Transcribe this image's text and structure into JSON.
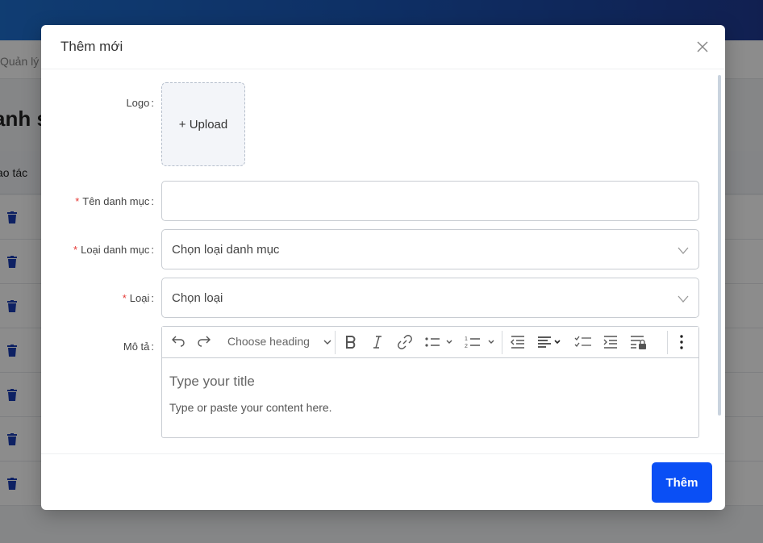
{
  "background": {
    "breadcrumb": "Quản lý",
    "page_title": "anh s",
    "table_header": "ao tác",
    "row_count": 7
  },
  "modal": {
    "title": "Thêm mới",
    "submit_label": "Thêm",
    "fields": {
      "logo": {
        "label": "Logo",
        "upload_text": "+ Upload"
      },
      "category_name": {
        "label": "Tên danh mục",
        "required": true,
        "value": ""
      },
      "category_type": {
        "label": "Loại danh mục",
        "required": true,
        "value": "Chọn loại danh mục"
      },
      "type": {
        "label": "Loại",
        "required": true,
        "value": "Chọn loại"
      },
      "description": {
        "label": "Mô tả",
        "heading_placeholder": "Choose heading",
        "title_placeholder": "Type your title",
        "content_placeholder": "Type or paste your content here."
      }
    }
  },
  "colors": {
    "primary": "#0a4ff5",
    "required": "#e53935",
    "icon_blue": "#1a3db5"
  }
}
